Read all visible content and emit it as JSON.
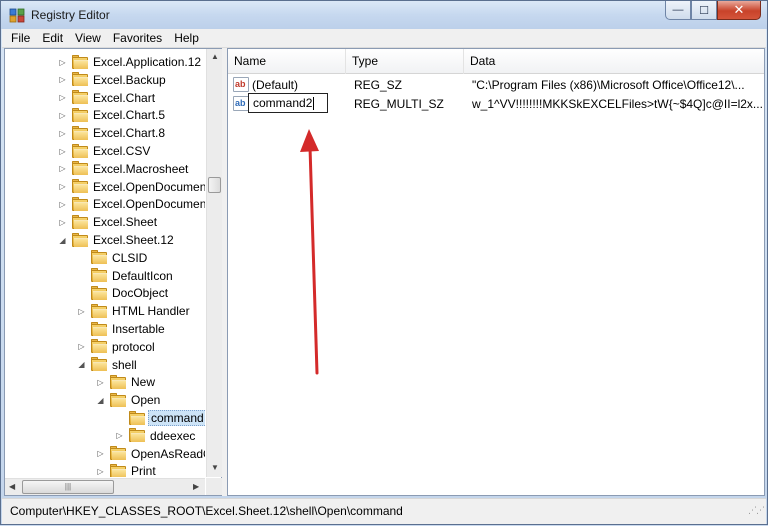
{
  "window": {
    "title": "Registry Editor",
    "minimize_glyph": "—",
    "maximize_glyph": "☐",
    "close_glyph": "✕"
  },
  "menu": [
    "File",
    "Edit",
    "View",
    "Favorites",
    "Help"
  ],
  "tree": {
    "items": [
      {
        "label": "Excel.Application.12",
        "depth": 0,
        "twisty": "▷"
      },
      {
        "label": "Excel.Backup",
        "depth": 0,
        "twisty": "▷"
      },
      {
        "label": "Excel.Chart",
        "depth": 0,
        "twisty": "▷"
      },
      {
        "label": "Excel.Chart.5",
        "depth": 0,
        "twisty": "▷"
      },
      {
        "label": "Excel.Chart.8",
        "depth": 0,
        "twisty": "▷"
      },
      {
        "label": "Excel.CSV",
        "depth": 0,
        "twisty": "▷"
      },
      {
        "label": "Excel.Macrosheet",
        "depth": 0,
        "twisty": "▷"
      },
      {
        "label": "Excel.OpenDocument",
        "depth": 0,
        "twisty": "▷"
      },
      {
        "label": "Excel.OpenDocument",
        "depth": 0,
        "twisty": "▷"
      },
      {
        "label": "Excel.Sheet",
        "depth": 0,
        "twisty": "▷"
      },
      {
        "label": "Excel.Sheet.12",
        "depth": 0,
        "twisty": "◢"
      },
      {
        "label": "CLSID",
        "depth": 1,
        "twisty": ""
      },
      {
        "label": "DefaultIcon",
        "depth": 1,
        "twisty": ""
      },
      {
        "label": "DocObject",
        "depth": 1,
        "twisty": ""
      },
      {
        "label": "HTML Handler",
        "depth": 1,
        "twisty": "▷"
      },
      {
        "label": "Insertable",
        "depth": 1,
        "twisty": ""
      },
      {
        "label": "protocol",
        "depth": 1,
        "twisty": "▷"
      },
      {
        "label": "shell",
        "depth": 1,
        "twisty": "◢"
      },
      {
        "label": "New",
        "depth": 2,
        "twisty": "▷"
      },
      {
        "label": "Open",
        "depth": 2,
        "twisty": "◢"
      },
      {
        "label": "command",
        "depth": 3,
        "twisty": "",
        "selected": true
      },
      {
        "label": "ddeexec",
        "depth": 3,
        "twisty": "▷"
      },
      {
        "label": "OpenAsReadO",
        "depth": 2,
        "twisty": "▷"
      },
      {
        "label": "Print",
        "depth": 2,
        "twisty": "▷"
      }
    ]
  },
  "list": {
    "columns": [
      "Name",
      "Type",
      "Data"
    ],
    "rows": [
      {
        "icon": "ab",
        "icon_kind": "string-value-icon",
        "name": "(Default)",
        "type": "REG_SZ",
        "data": "\"C:\\Program Files (x86)\\Microsoft Office\\Office12\\..."
      },
      {
        "icon": "ab",
        "icon_kind": "multi-string-value-icon",
        "name": "command2",
        "type": "REG_MULTI_SZ",
        "data": "w_1^VV!!!!!!!!MKKSkEXCELFiles>tW{~$4Q]c@II=l2x...",
        "editing": true
      }
    ]
  },
  "status": {
    "path": "Computer\\HKEY_CLASSES_ROOT\\Excel.Sheet.12\\shell\\Open\\command"
  },
  "colors": {
    "arrow": "#d42a2a",
    "selection": "#cde4f7"
  }
}
